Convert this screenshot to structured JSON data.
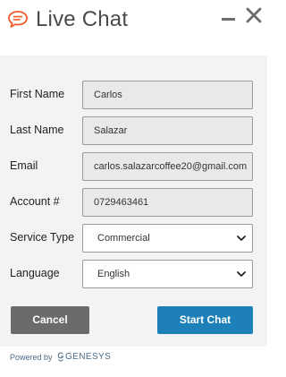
{
  "header": {
    "title": "Live Chat",
    "icons": {
      "chat": "chat-bubble-icon",
      "minimize": "minimize-icon",
      "close": "close-icon"
    },
    "accent_color": "#f05a28"
  },
  "form": {
    "first_name": {
      "label": "First Name",
      "value": "Carlos"
    },
    "last_name": {
      "label": "Last Name",
      "value": "Salazar"
    },
    "email": {
      "label": "Email",
      "value": "carlos.salazarcoffee20@gmail.com"
    },
    "account": {
      "label": "Account #",
      "value": "0729463461"
    },
    "service_type": {
      "label": "Service Type",
      "selected": "Commercial"
    },
    "language": {
      "label": "Language",
      "selected": "English"
    }
  },
  "buttons": {
    "cancel": "Cancel",
    "start_chat": "Start Chat",
    "cancel_color": "#6b6b6b",
    "start_color": "#1e80b8"
  },
  "footer": {
    "powered_by": "Powered by",
    "brand": "GENESYS"
  }
}
